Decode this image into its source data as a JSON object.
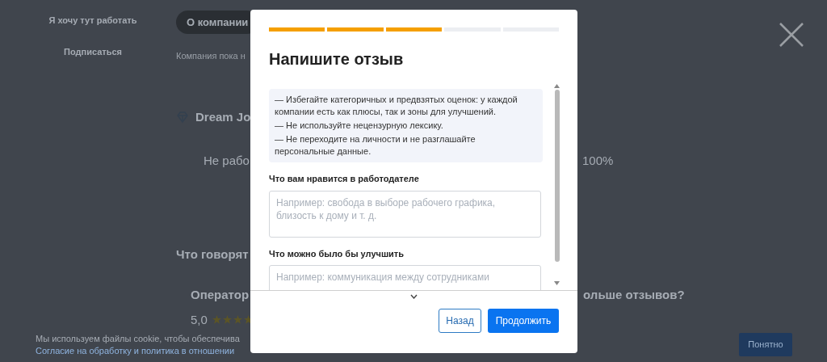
{
  "background_page": {
    "sidebar_actions": [
      "Я хочу тут работать",
      "Подписаться"
    ],
    "tabs": [
      {
        "label": "О компании",
        "selected": true
      }
    ],
    "company_note": "Компания пока н",
    "company_name": "Dream Jo",
    "status_text": "Не рабо",
    "percent": "100%",
    "reviews_heading": "Что говорят",
    "review": {
      "title": "Оператор",
      "rating": "5,0",
      "stars": 4
    },
    "more_reviews": "ольше отзывов?",
    "cookie": {
      "text": "Мы используем файлы cookie, чтобы обеспечива",
      "link": "Согласие на обработку и политика в отношении",
      "button": "Понятно"
    }
  },
  "modal": {
    "progress": [
      {
        "filled": true
      },
      {
        "filled": true
      },
      {
        "filled": true
      },
      {
        "filled": false
      },
      {
        "filled": false
      }
    ],
    "title": "Напишите отзыв",
    "rules": [
      "— Избегайте категоричных и предвзятых оценок: у каждой компании есть как плюсы, так и зоны для улучшений.",
      "— Не используйте нецензурную лексику.",
      "— Не переходите на личности и не разглашайте персональные данные."
    ],
    "fields": [
      {
        "label": "Что вам нравится в работодателе",
        "placeholder": "Например: свобода в выборе рабочего графика, близость к дому и т. д."
      },
      {
        "label": "Что можно было бы улучшить",
        "placeholder": "Например: коммуникация между сотрудниками"
      }
    ],
    "buttons": {
      "back": "Назад",
      "next": "Продолжить"
    }
  }
}
